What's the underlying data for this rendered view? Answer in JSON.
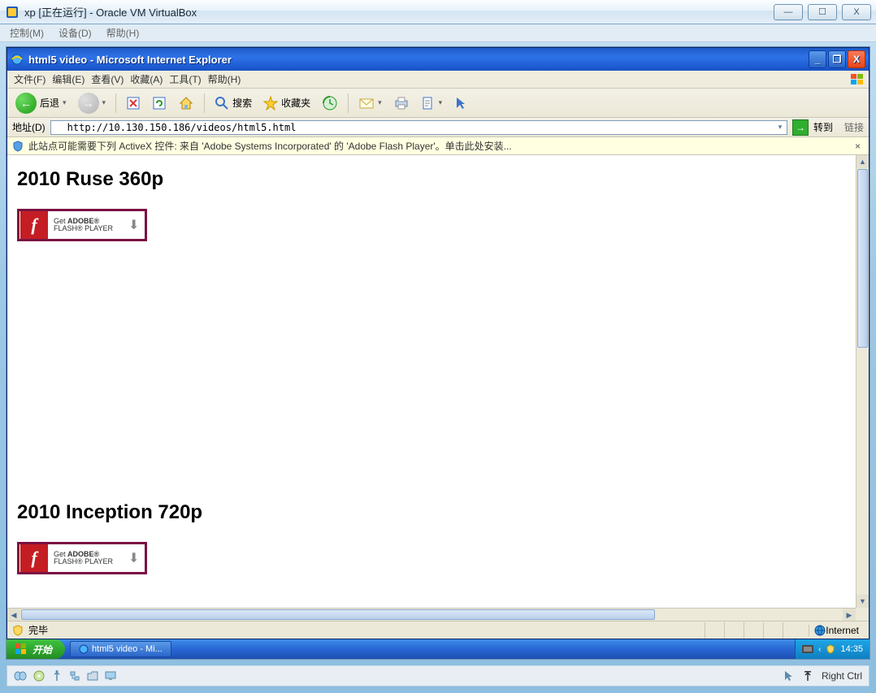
{
  "vb": {
    "title": "xp [正在运行] - Oracle VM VirtualBox",
    "menu": {
      "control": "控制(M)",
      "devices": "设备(D)",
      "help": "帮助(H)"
    },
    "status": {
      "hostkey": "Right Ctrl"
    }
  },
  "ie": {
    "title": "html5 video - Microsoft Internet Explorer",
    "menu": {
      "file": "文件(F)",
      "edit": "编辑(E)",
      "view": "查看(V)",
      "favorites": "收藏(A)",
      "tools": "工具(T)",
      "help": "帮助(H)"
    },
    "toolbar": {
      "back": "后退",
      "search": "搜索",
      "favorites": "收藏夹"
    },
    "address": {
      "label": "地址(D)",
      "url": "http://10.130.150.186/videos/html5.html",
      "go": "转到",
      "links": "链接"
    },
    "infobar": {
      "text": "此站点可能需要下列 ActiveX 控件: 来自 'Adobe Systems Incorporated' 的 'Adobe Flash Player'。单击此处安装..."
    },
    "status": {
      "done": "完毕",
      "zone": "Internet"
    }
  },
  "page": {
    "headings": [
      {
        "text": "2010 Ruse 360p"
      },
      {
        "text": "2010 Inception 720p"
      }
    ],
    "flash": {
      "line1_pre": "Get ",
      "line1_bold": "ADOBE®",
      "line2": "FLASH® PLAYER"
    }
  },
  "xp": {
    "start": "开始",
    "task": {
      "label": "html5 video - Mi..."
    },
    "tray": {
      "clock": "14:35"
    }
  }
}
